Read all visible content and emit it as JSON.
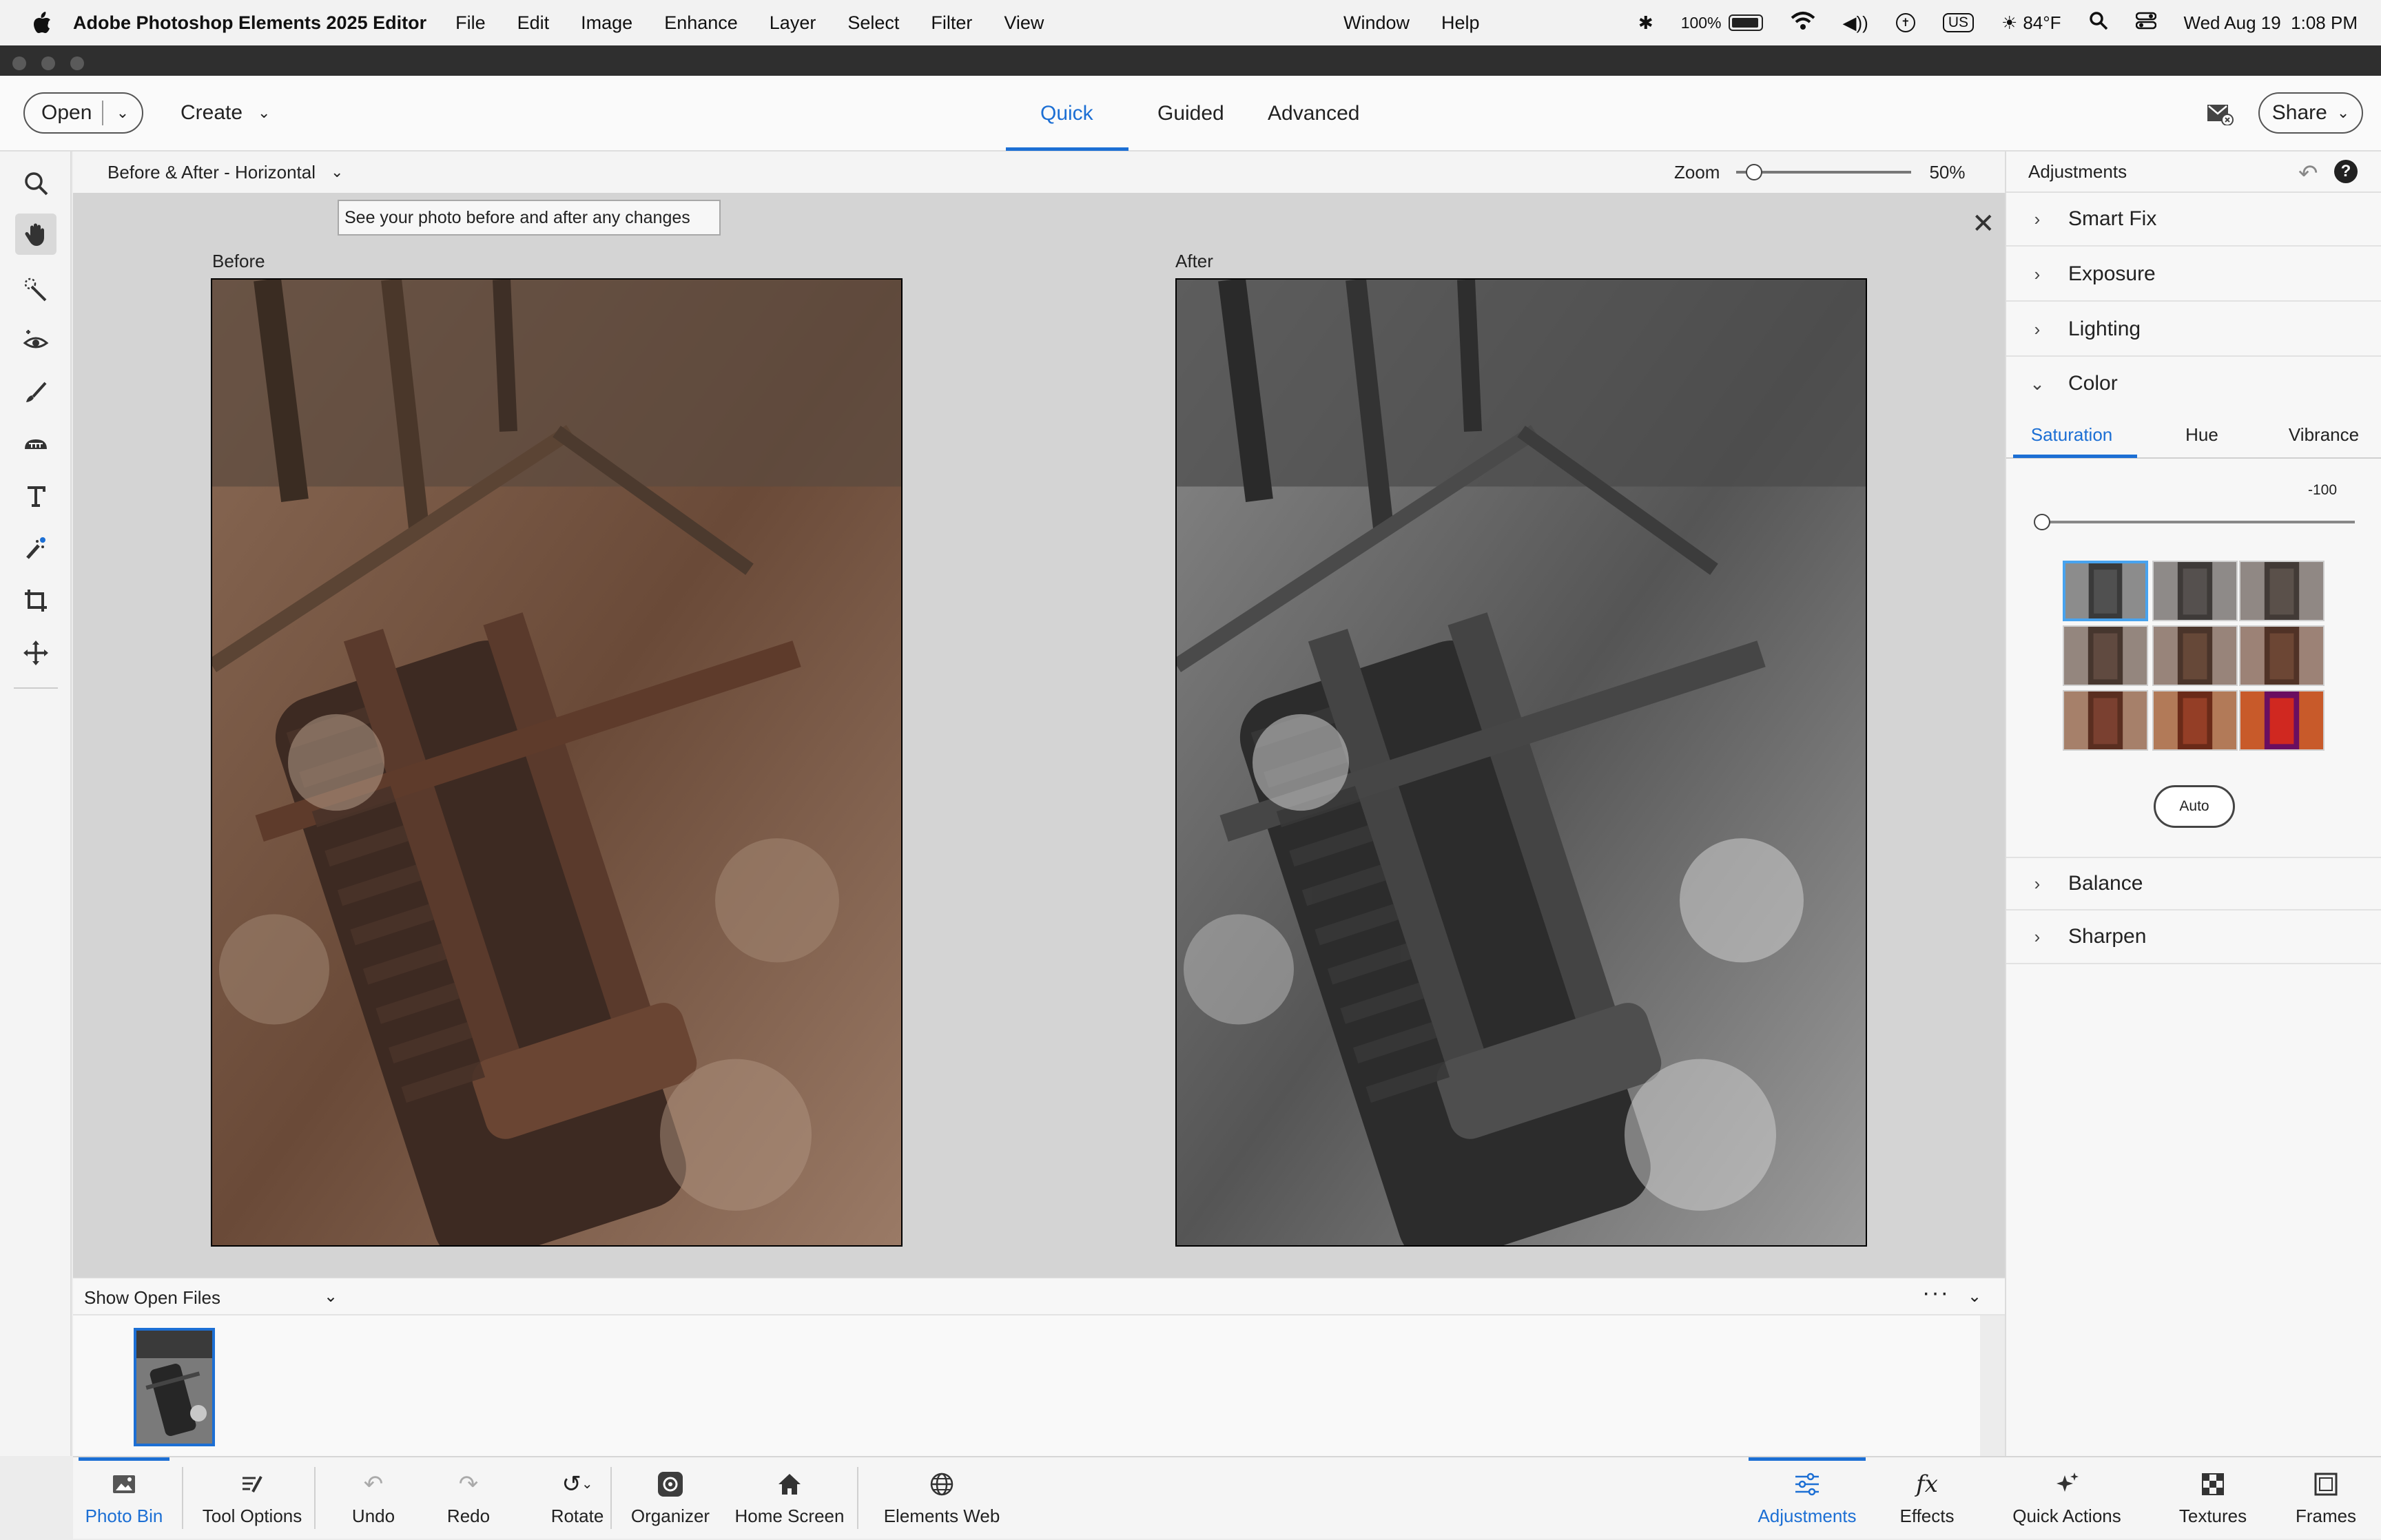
{
  "menubar": {
    "app_name": "Adobe Photoshop Elements 2025 Editor",
    "menus": [
      "File",
      "Edit",
      "Image",
      "Enhance",
      "Layer",
      "Select",
      "Filter",
      "View"
    ],
    "right_menus": [
      "Window",
      "Help"
    ],
    "battery": "100%",
    "input_source": "US",
    "weather": "84°F",
    "datetime": "Wed Aug 19  1:08 PM"
  },
  "toolbar": {
    "open_label": "Open",
    "create_label": "Create",
    "modes": [
      "Quick",
      "Guided",
      "Advanced"
    ],
    "active_mode": "Quick",
    "share_label": "Share"
  },
  "tools": [
    "zoom-tool",
    "hand-tool",
    "quick-selection-tool",
    "eye-tool",
    "whiten-teeth-tool",
    "straighten-tool",
    "type-tool",
    "spot-healing-tool",
    "crop-tool",
    "move-tool"
  ],
  "options": {
    "view_mode": "Before & After - Horizontal",
    "zoom_label": "Zoom",
    "zoom_value": "50%",
    "zoom_fraction": 0.1
  },
  "canvas": {
    "tooltip": "See your photo before and after any changes",
    "before_label": "Before",
    "after_label": "After"
  },
  "adjustments": {
    "title": "Adjustments",
    "sections_top": [
      "Smart Fix",
      "Exposure",
      "Lighting"
    ],
    "color_label": "Color",
    "color_tabs": [
      "Saturation",
      "Hue",
      "Vibrance"
    ],
    "active_tab": "Saturation",
    "saturation_value": "-100",
    "saturation_fraction": 0,
    "auto_label": "Auto",
    "sections_bottom": [
      "Balance",
      "Sharpen"
    ]
  },
  "photo_bin": {
    "select_label": "Show Open Files"
  },
  "taskbar": {
    "left": [
      {
        "label": "Photo Bin",
        "icon": "photo-bin-icon"
      },
      {
        "label": "Tool Options",
        "icon": "tool-options-icon"
      },
      {
        "label": "Undo",
        "icon": "undo-icon"
      },
      {
        "label": "Redo",
        "icon": "redo-icon"
      },
      {
        "label": "Rotate",
        "icon": "rotate-icon"
      },
      {
        "label": "Organizer",
        "icon": "organizer-icon"
      },
      {
        "label": "Home Screen",
        "icon": "home-icon"
      },
      {
        "label": "Elements Web",
        "icon": "globe-icon"
      }
    ],
    "right": [
      {
        "label": "Adjustments",
        "icon": "adjustments-icon"
      },
      {
        "label": "Effects",
        "icon": "effects-icon"
      },
      {
        "label": "Quick Actions",
        "icon": "quick-actions-icon"
      },
      {
        "label": "Textures",
        "icon": "textures-icon"
      },
      {
        "label": "Frames",
        "icon": "frames-icon"
      }
    ]
  },
  "colors": {
    "accent": "#1c6fd4",
    "preset_highlight": "#48a3ee"
  }
}
